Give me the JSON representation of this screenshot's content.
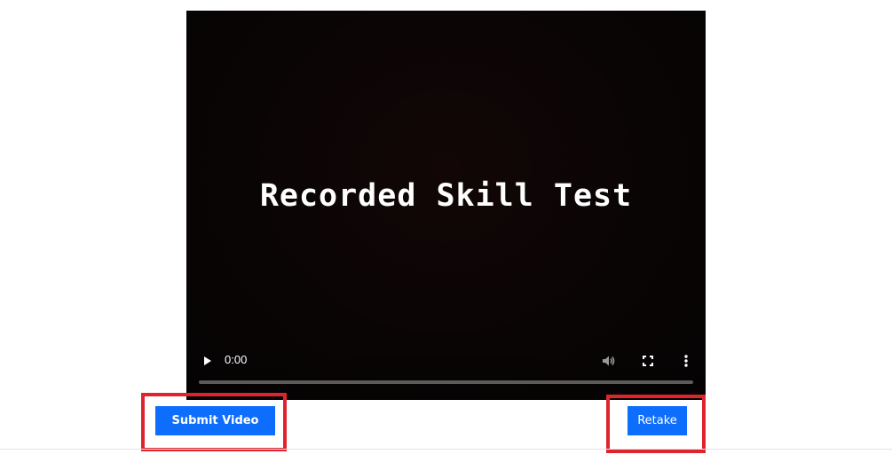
{
  "video": {
    "overlay_title": "Recorded Skill Test",
    "current_time": "0:00",
    "progress_fraction": 0,
    "icons": {
      "play": "play-icon",
      "volume": "volume-icon",
      "fullscreen": "fullscreen-icon",
      "more": "more-options-icon"
    }
  },
  "actions": {
    "submit_label": "Submit Video",
    "retake_label": "Retake"
  },
  "colors": {
    "button_primary": "#0d6efd",
    "highlight_border": "#e0242e",
    "player_background": "#080404"
  }
}
